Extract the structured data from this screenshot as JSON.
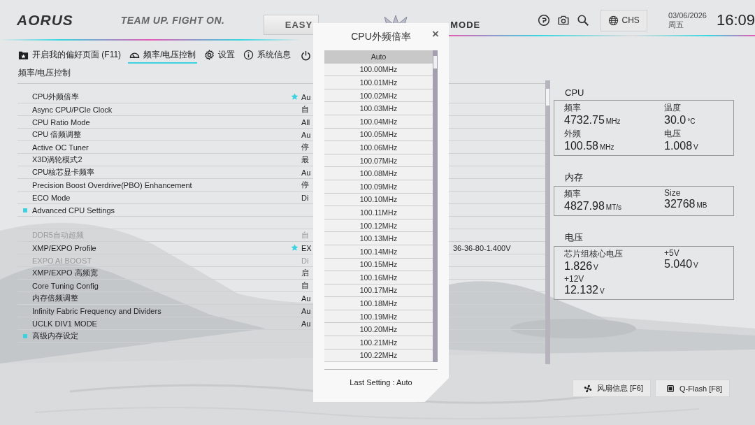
{
  "header": {
    "logo": "AORUS",
    "slogan": "TEAM UP. FIGHT ON.",
    "modes": [
      {
        "label": "EASY",
        "selected": false
      },
      {
        "label": "MODE",
        "selected": true
      }
    ],
    "language": "CHS",
    "date": "03/06/2026",
    "weekday": "周五",
    "time": "16:09"
  },
  "nav": [
    {
      "label": "开启我的偏好页面 (F11)",
      "kind": "favorites",
      "selected": false
    },
    {
      "label": "频率/电压控制",
      "kind": "gauge",
      "selected": true
    },
    {
      "label": "设置",
      "kind": "gear",
      "selected": false
    },
    {
      "label": "系统信息",
      "kind": "info",
      "selected": false
    }
  ],
  "breadcrumb": "频率/电压控制",
  "cpu_items": [
    {
      "label": "CPU外频倍率",
      "value": "Au",
      "favorite": true,
      "disabled": false,
      "kind": "setting"
    },
    {
      "label": "Async CPU/PCIe Clock",
      "value": "自",
      "favorite": false,
      "disabled": false,
      "kind": "setting"
    },
    {
      "label": "CPU Ratio Mode",
      "value": "All",
      "favorite": false,
      "disabled": false,
      "kind": "setting"
    },
    {
      "label": "CPU 倍频调整",
      "value": "Au",
      "favorite": false,
      "disabled": false,
      "kind": "setting"
    },
    {
      "label": "Active OC Tuner",
      "value": "停",
      "favorite": false,
      "disabled": false,
      "kind": "setting"
    },
    {
      "label": "X3D涡轮模式2",
      "value": "最",
      "favorite": false,
      "disabled": false,
      "kind": "setting"
    },
    {
      "label": "CPU核芯显卡频率",
      "value": "Au",
      "favorite": false,
      "disabled": false,
      "kind": "setting"
    },
    {
      "label": "Precision Boost Overdrive(PBO) Enhancement",
      "value": "停",
      "favorite": false,
      "disabled": false,
      "kind": "setting"
    },
    {
      "label": "ECO Mode",
      "value": "Di",
      "favorite": false,
      "disabled": false,
      "kind": "setting"
    },
    {
      "label": "Advanced CPU Settings",
      "favorite": false,
      "disabled": false,
      "kind": "submenu"
    }
  ],
  "memory_items": [
    {
      "label": "DDR5自动超频",
      "value": "自",
      "favorite": false,
      "disabled": true,
      "kind": "setting"
    },
    {
      "label": "XMP/EXPO Profile",
      "value": "EX",
      "value_tail": "36-36-80-1.400V",
      "favorite": true,
      "disabled": false,
      "kind": "setting"
    },
    {
      "label": "EXPO AI BOOST",
      "value": "Di",
      "favorite": false,
      "disabled": true,
      "kind": "setting"
    },
    {
      "label": "XMP/EXPO 高频宽",
      "value": "启",
      "favorite": false,
      "disabled": false,
      "kind": "setting"
    },
    {
      "label": "Core Tuning Config",
      "value": "自",
      "favorite": false,
      "disabled": false,
      "kind": "setting"
    },
    {
      "label": "内存倍频调整",
      "value": "Au",
      "favorite": false,
      "disabled": false,
      "kind": "setting"
    },
    {
      "label": "Infinity Fabric Frequency and Dividers",
      "value": "Au",
      "favorite": false,
      "disabled": false,
      "kind": "setting"
    },
    {
      "label": "UCLK DIV1 MODE",
      "value": "Au",
      "favorite": false,
      "disabled": false,
      "kind": "setting"
    },
    {
      "label": "高级内存设定",
      "favorite": false,
      "disabled": false,
      "kind": "submenu"
    }
  ],
  "monitor": [
    {
      "title": "CPU",
      "fields": [
        {
          "label": "频率",
          "value": "4732.75",
          "unit": "MHz"
        },
        {
          "label": "温度",
          "value": "30.0",
          "unit": "°C"
        },
        {
          "label": "外频",
          "value": "100.58",
          "unit": "MHz"
        },
        {
          "label": "电压",
          "value": "1.008",
          "unit": "V"
        }
      ]
    },
    {
      "title": "内存",
      "fields": [
        {
          "label": "频率",
          "value": "4827.98",
          "unit": "MT/s"
        },
        {
          "label": "Size",
          "value": "32768",
          "unit": "MB"
        }
      ]
    },
    {
      "title": "电压",
      "fields": [
        {
          "label": "芯片组核心电压",
          "value": "1.826",
          "unit": "V"
        },
        {
          "label": "+5V",
          "value": "5.040",
          "unit": "V"
        },
        {
          "label": "+12V",
          "value": "12.132",
          "unit": "V"
        }
      ]
    }
  ],
  "bottom_buttons": [
    {
      "label": "风扇信息 [F6]",
      "kind": "fan"
    },
    {
      "label": "Q-Flash [F8]",
      "kind": "chip"
    }
  ],
  "dialog": {
    "title": "CPU外频倍率",
    "close": "×",
    "options": [
      {
        "label": "Auto",
        "selected": true
      },
      {
        "label": "100.00MHz",
        "selected": false
      },
      {
        "label": "100.01MHz",
        "selected": false
      },
      {
        "label": "100.02MHz",
        "selected": false
      },
      {
        "label": "100.03MHz",
        "selected": false
      },
      {
        "label": "100.04MHz",
        "selected": false
      },
      {
        "label": "100.05MHz",
        "selected": false
      },
      {
        "label": "100.06MHz",
        "selected": false
      },
      {
        "label": "100.07MHz",
        "selected": false
      },
      {
        "label": "100.08MHz",
        "selected": false
      },
      {
        "label": "100.09MHz",
        "selected": false
      },
      {
        "label": "100.10MHz",
        "selected": false
      },
      {
        "label": "100.11MHz",
        "selected": false
      },
      {
        "label": "100.12MHz",
        "selected": false
      },
      {
        "label": "100.13MHz",
        "selected": false
      },
      {
        "label": "100.14MHz",
        "selected": false
      },
      {
        "label": "100.15MHz",
        "selected": false
      },
      {
        "label": "100.16MHz",
        "selected": false
      },
      {
        "label": "100.17MHz",
        "selected": false
      },
      {
        "label": "100.18MHz",
        "selected": false
      },
      {
        "label": "100.19MHz",
        "selected": false
      },
      {
        "label": "100.20MHz",
        "selected": false
      },
      {
        "label": "100.21MHz",
        "selected": false
      },
      {
        "label": "100.22MHz",
        "selected": false
      }
    ],
    "footer": "Last Setting : Auto"
  }
}
